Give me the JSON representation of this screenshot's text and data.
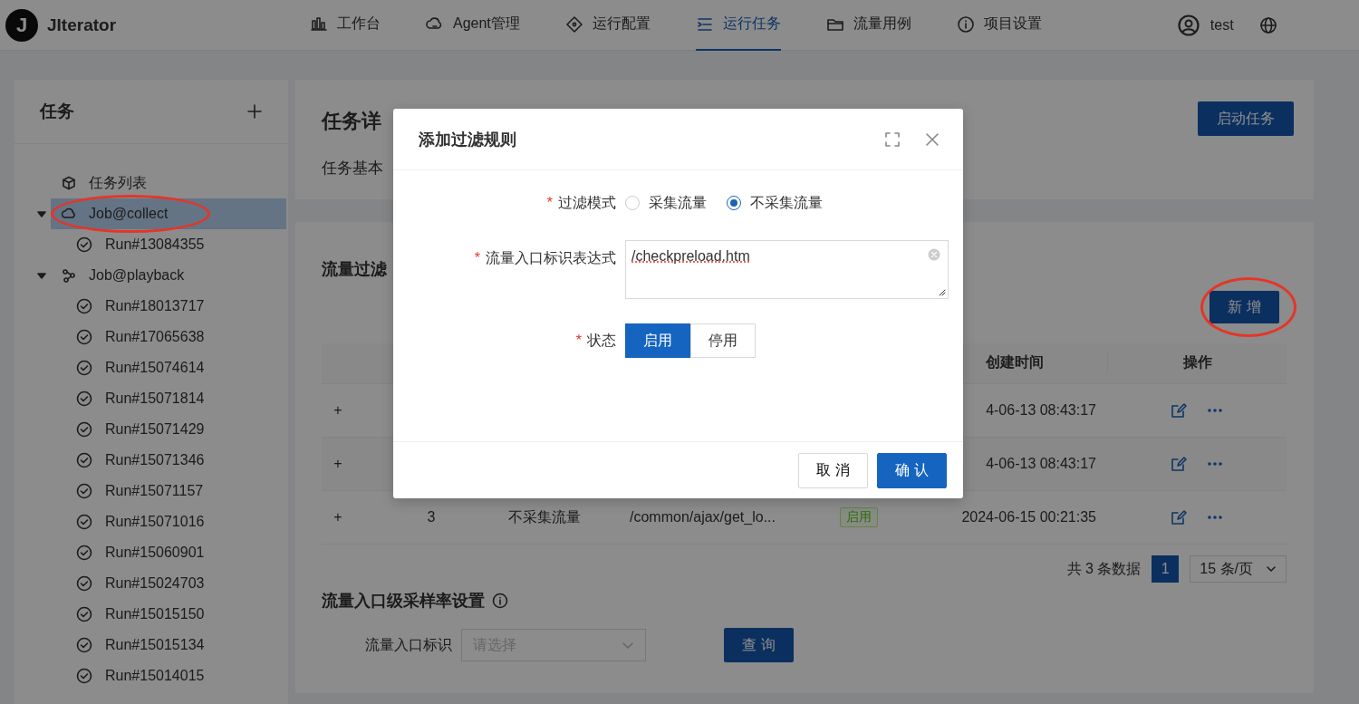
{
  "app": {
    "logo_letter": "J",
    "name": "JIterator"
  },
  "nav": [
    {
      "label": "工作台",
      "selected": false
    },
    {
      "label": "Agent管理",
      "selected": false
    },
    {
      "label": "运行配置",
      "selected": false
    },
    {
      "label": "运行任务",
      "selected": true
    },
    {
      "label": "流量用例",
      "selected": false
    },
    {
      "label": "项目设置",
      "selected": false
    }
  ],
  "user": {
    "name": "test"
  },
  "sidebar": {
    "title": "任务",
    "tree": [
      {
        "label": "任务列表",
        "kind": "list",
        "selected": false,
        "annotated": false
      },
      {
        "label": "Job@collect",
        "kind": "collect",
        "expanded": true,
        "selected": true,
        "annotated": true,
        "children": [
          {
            "label": "Run#13084355",
            "selected": false
          }
        ]
      },
      {
        "label": "Job@playback",
        "kind": "playback",
        "expanded": true,
        "selected": false,
        "annotated": false,
        "children": [
          {
            "label": "Run#18013717",
            "selected": false
          },
          {
            "label": "Run#17065638",
            "selected": false
          },
          {
            "label": "Run#15074614",
            "selected": false
          },
          {
            "label": "Run#15071814",
            "selected": false
          },
          {
            "label": "Run#15071429",
            "selected": false
          },
          {
            "label": "Run#15071346",
            "selected": false
          },
          {
            "label": "Run#15071157",
            "selected": false
          },
          {
            "label": "Run#15071016",
            "selected": false
          },
          {
            "label": "Run#15060901",
            "selected": false
          },
          {
            "label": "Run#15024703",
            "selected": false
          },
          {
            "label": "Run#15015150",
            "selected": false
          },
          {
            "label": "Run#15015134",
            "selected": false
          },
          {
            "label": "Run#15014015",
            "selected": false
          }
        ]
      }
    ]
  },
  "task_card": {
    "title": "任务详",
    "start_button": "启动任务",
    "tab": "任务基本"
  },
  "filter_section": {
    "title": "流量过滤",
    "add_button": {
      "label": "新 增",
      "annotated": true
    },
    "table": {
      "columns": [
        {
          "label": "创建时间"
        },
        {
          "label": "操作"
        }
      ],
      "rows": [
        {
          "expand": "+",
          "created": "4-06-13 08:43:17"
        },
        {
          "expand": "+",
          "created": "4-06-13 08:43:17"
        },
        {
          "expand": "+",
          "index": "3",
          "mode": "不采集流量",
          "expression": "/common/ajax/get_lo...",
          "status": {
            "label": "启用",
            "kind": "success"
          },
          "created": "2024-06-15 00:21:35"
        }
      ]
    },
    "pagination": {
      "total": "共 3 条数据",
      "pages": [
        {
          "label": "1",
          "selected": true
        }
      ],
      "page_size": "15 条/页"
    }
  },
  "sampling": {
    "title": "流量入口级采样率设置",
    "filter_label": "流量入口标识",
    "select_placeholder": "请选择",
    "query_button": "查 询"
  },
  "modal": {
    "title": "添加过滤规则",
    "fields": [
      {
        "kind": "radio",
        "required_mark": "*",
        "label": "过滤模式",
        "options": [
          {
            "label": "采集流量",
            "selected": false
          },
          {
            "label": "不采集流量",
            "selected": true
          }
        ]
      },
      {
        "kind": "textarea",
        "required_mark": "*",
        "label": "流量入口标识表达式",
        "value": "/checkpreload.htm"
      },
      {
        "kind": "segmented",
        "required_mark": "*",
        "label": "状态",
        "options": [
          {
            "label": "启用",
            "selected": true
          },
          {
            "label": "停用",
            "selected": false
          }
        ]
      }
    ],
    "buttons": [
      {
        "label": "取 消",
        "kind": "default"
      },
      {
        "label": "确 认",
        "kind": "primary"
      }
    ]
  }
}
